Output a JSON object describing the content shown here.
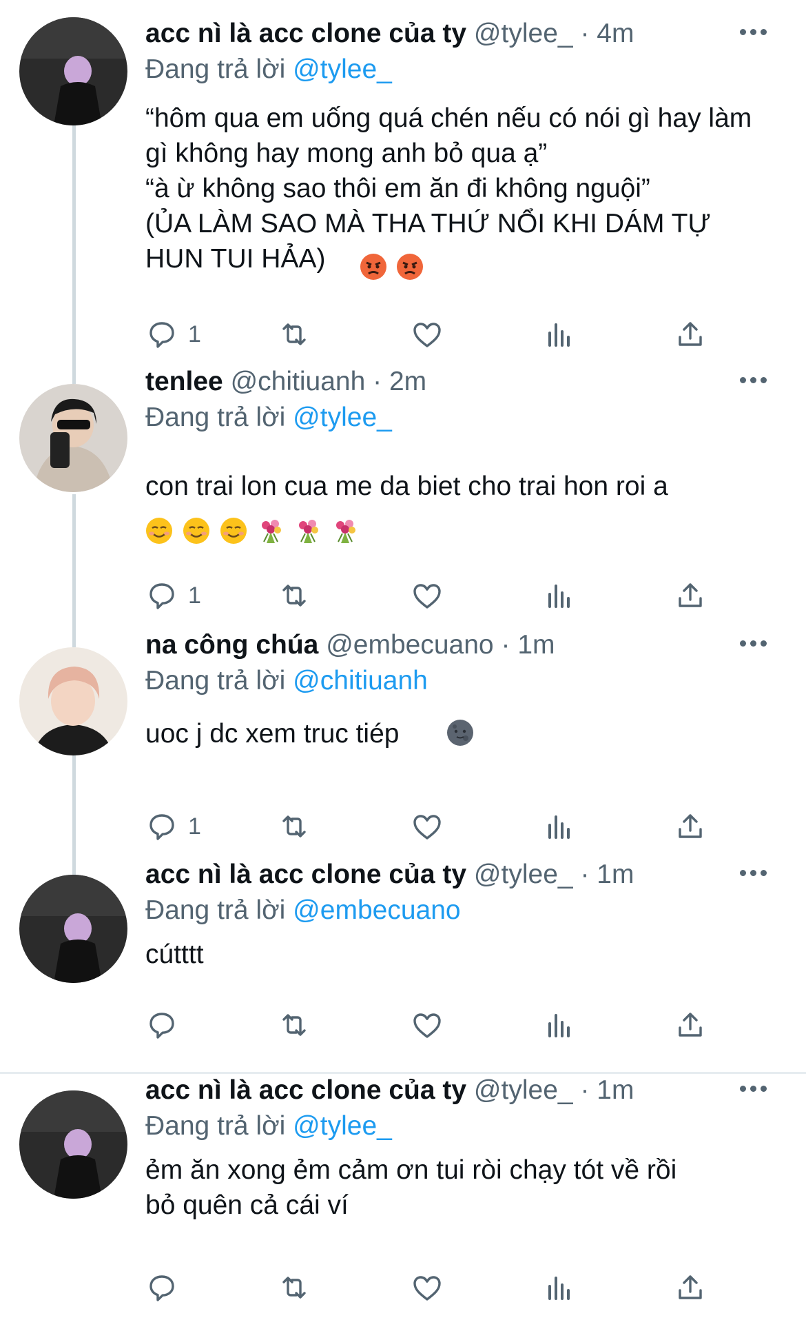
{
  "colors": {
    "accent": "#1d9bf0",
    "muted": "#536471",
    "text": "#0f1419",
    "thread_line": "#cfd9de"
  },
  "action_icons": [
    "reply-icon",
    "retweet-icon",
    "like-icon",
    "views-icon",
    "share-icon"
  ],
  "tweets": [
    {
      "name": "acc nì là acc clone của ty",
      "handle": "@tylee_",
      "separator": "·",
      "time": "4m",
      "reply_prefix": "Đang trả lời",
      "reply_to": "@tylee_",
      "text": "“hôm qua em uống quá chén nếu có nói gì hay làm gì không hay mong anh bỏ qua ạ”\n“à ừ không sao thôi em ăn đi không nguội”\n(ỦA LÀM SAO MÀ THA THỨ NỔI KHI DÁM TỰ\nHUN TUI HẢA)",
      "emojis": [
        "angry-face-icon",
        "angry-face-icon"
      ],
      "reply_count": "1"
    },
    {
      "name": "tenlee",
      "handle": "@chitiuanh",
      "separator": "·",
      "time": "2m",
      "reply_prefix": "Đang trả lời",
      "reply_to": "@tylee_",
      "text": "con trai lon cua me da biet cho trai hon roi a",
      "emojis": [
        "smiling-face-icon",
        "smiling-face-icon",
        "smiling-face-icon",
        "bouquet-icon",
        "bouquet-icon",
        "bouquet-icon"
      ],
      "reply_count": "1"
    },
    {
      "name": "na công chúa",
      "handle": "@embecuano",
      "separator": "·",
      "time": "1m",
      "reply_prefix": "Đang trả lời",
      "reply_to": "@chitiuanh",
      "text": "uoc j dc xem truc tiép",
      "emojis": [
        "new-moon-face-icon"
      ],
      "reply_count": "1"
    },
    {
      "name": "acc nì là acc clone của ty",
      "handle": "@tylee_",
      "separator": "·",
      "time": "1m",
      "reply_prefix": "Đang trả lời",
      "reply_to": "@embecuano",
      "text": "cútttt",
      "emojis": [],
      "reply_count": ""
    },
    {
      "name": "acc nì là acc clone của ty",
      "handle": "@tylee_",
      "separator": "·",
      "time": "1m",
      "reply_prefix": "Đang trả lời",
      "reply_to": "@tylee_",
      "text": "ẻm ăn xong ẻm cảm ơn tui ròi chạy tót về rồi\nbỏ quên cả cái ví",
      "emojis": [],
      "reply_count": ""
    }
  ]
}
